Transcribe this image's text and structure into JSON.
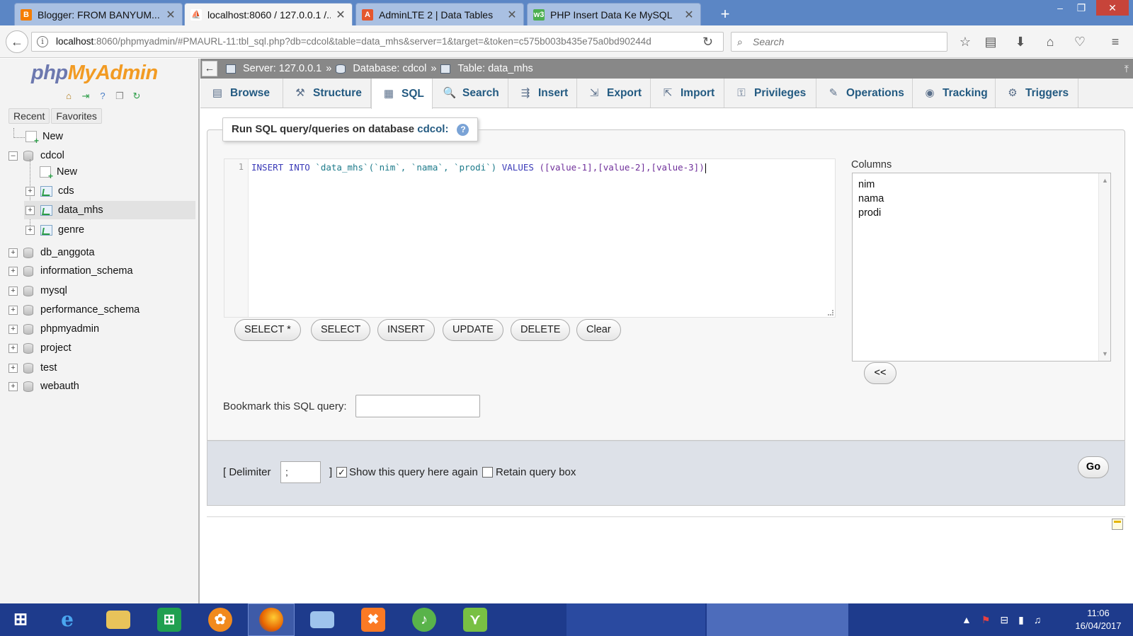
{
  "browser": {
    "tabs": [
      {
        "title": "Blogger: FROM BANYUM...",
        "icon": "blogger-icon",
        "color": "#f57d00"
      },
      {
        "title": "localhost:8060 / 127.0.0.1 /...",
        "icon": "phpmyadmin-icon",
        "color": "#f29b23",
        "active": true
      },
      {
        "title": "AdminLTE 2 | Data Tables",
        "icon": "adminlte-icon",
        "color": "#e4572e"
      },
      {
        "title": "PHP Insert Data Ke MySQL",
        "icon": "w3-icon",
        "color": "#4caf50"
      }
    ],
    "url_host": "localhost",
    "url_rest": ":8060/phpmyadmin/#PMAURL-11:tbl_sql.php?db=cdcol&table=data_mhs&server=1&target=&token=c575b003b435e75a0bd90244d",
    "search_placeholder": "Search"
  },
  "nav": {
    "logo_php": "php",
    "logo_myadmin": "MyAdmin",
    "tab_recent": "Recent",
    "tab_favorites": "Favorites",
    "new_label": "New",
    "databases": [
      {
        "name": "cdcol",
        "expanded": true
      },
      {
        "name": "db_anggota"
      },
      {
        "name": "information_schema"
      },
      {
        "name": "mysql"
      },
      {
        "name": "performance_schema"
      },
      {
        "name": "phpmyadmin"
      },
      {
        "name": "project"
      },
      {
        "name": "test"
      },
      {
        "name": "webauth"
      }
    ],
    "cdcol_children": [
      "New",
      "cds",
      "data_mhs",
      "genre"
    ]
  },
  "breadcrumb": {
    "server": "Server: 127.0.0.1",
    "database": "Database: cdcol",
    "table": "Table: data_mhs",
    "sep": "»"
  },
  "menu": [
    {
      "label": "Browse",
      "icon": "browse-icon",
      "glyph": "▤"
    },
    {
      "label": "Structure",
      "icon": "structure-icon",
      "glyph": "⚒"
    },
    {
      "label": "SQL",
      "icon": "sql-icon",
      "glyph": "▦",
      "active": true
    },
    {
      "label": "Search",
      "icon": "search-icon",
      "glyph": "🔍"
    },
    {
      "label": "Insert",
      "icon": "insert-icon",
      "glyph": "⇶"
    },
    {
      "label": "Export",
      "icon": "export-icon",
      "glyph": "⇲"
    },
    {
      "label": "Import",
      "icon": "import-icon",
      "glyph": "⇱"
    },
    {
      "label": "Privileges",
      "icon": "privileges-icon",
      "glyph": "⚿"
    },
    {
      "label": "Operations",
      "icon": "operations-icon",
      "glyph": "✎"
    },
    {
      "label": "Tracking",
      "icon": "tracking-icon",
      "glyph": "◉"
    },
    {
      "label": "Triggers",
      "icon": "triggers-icon",
      "glyph": "⚙"
    }
  ],
  "sqlpanel": {
    "legend_prefix": "Run SQL query/queries on database ",
    "legend_db": "cdcol:",
    "line_number": "1",
    "query": {
      "kw1": "INSERT INTO",
      "table": "`data_mhs`",
      "cols": "(`nim`, `nama`, `prodi`)",
      "kw2": "VALUES",
      "vals": "([value-1],[value-2],[value-3])"
    },
    "buttons": [
      "SELECT *",
      "SELECT",
      "INSERT",
      "UPDATE",
      "DELETE",
      "Clear"
    ],
    "columns_label": "Columns",
    "columns": [
      "nim",
      "nama",
      "prodi"
    ],
    "insert_col_button": "<<",
    "bookmark_label": "Bookmark this SQL query:",
    "bookmark_value": ""
  },
  "footer": {
    "delimiter_label": "[ Delimiter",
    "delimiter_value": ";",
    "delimiter_close": "]",
    "show_again_label": "Show this query here again",
    "show_again_checked": true,
    "retain_label": "Retain query box",
    "retain_checked": false,
    "go_label": "Go"
  },
  "taskbar": {
    "clock_time": "11:06",
    "clock_date": "16/04/2017"
  }
}
